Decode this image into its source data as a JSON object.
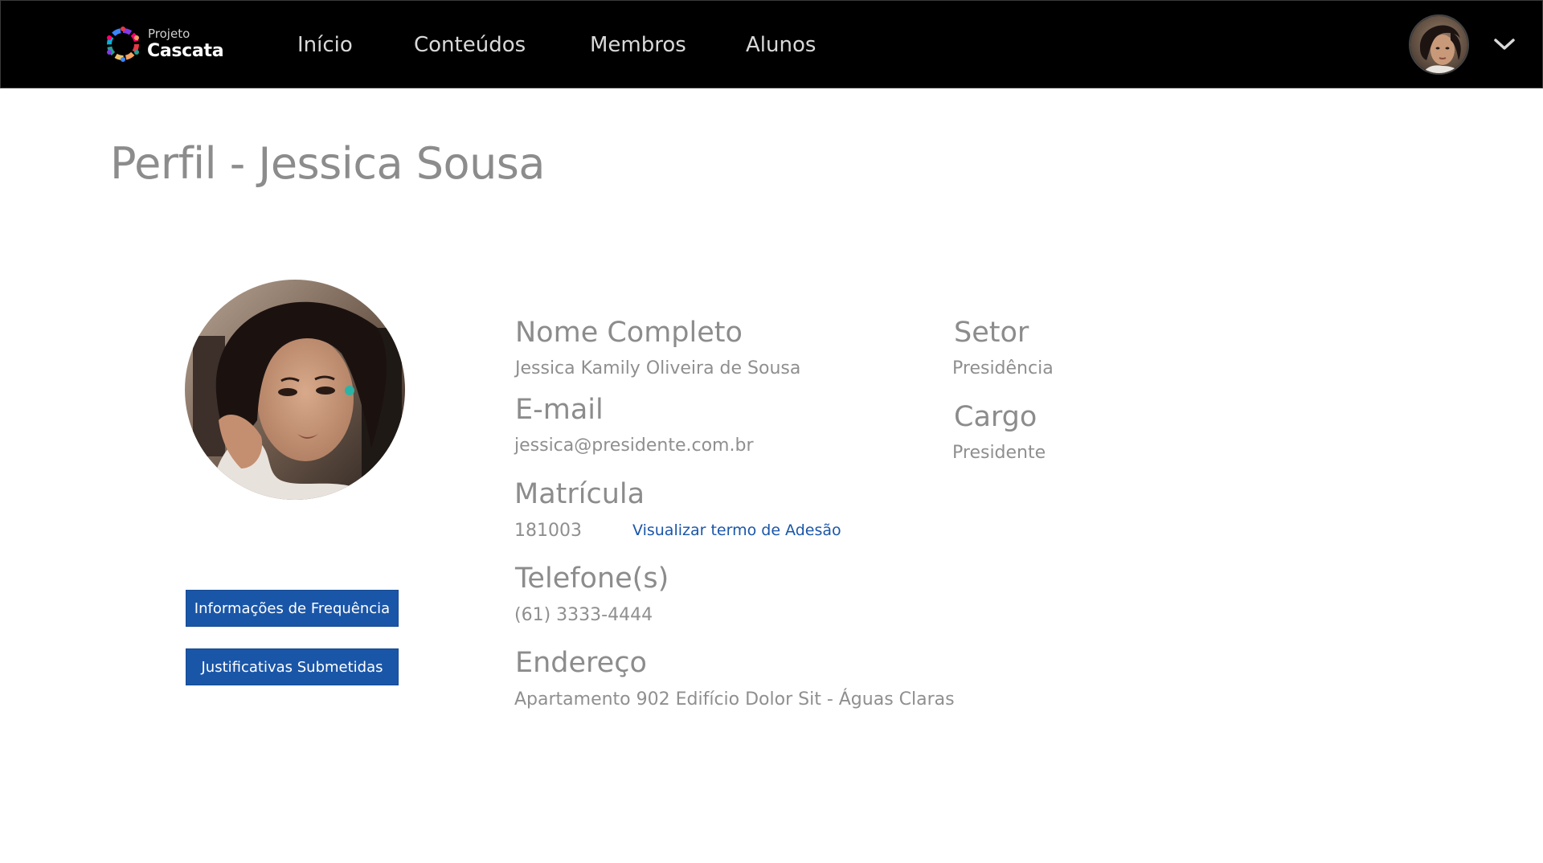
{
  "nav": {
    "logo_small": "Projeto",
    "logo_big": "Cascata",
    "links": [
      "Início",
      "Conteúdos",
      "Membros",
      "Alunos"
    ],
    "menu_icon": "chevron-down-icon"
  },
  "page": {
    "title": "Perfil - Jessica Sousa"
  },
  "actions": {
    "frequency_button": "Informações de Frequência",
    "justifications_button": "Justificativas Submetidas"
  },
  "profile": {
    "name_label": "Nome Completo",
    "name_value": "Jessica Kamily Oliveira de Sousa",
    "email_label": "E-mail",
    "email_value": "jessica@presidente.com.br",
    "registration_label": "Matrícula",
    "registration_value": "181003",
    "term_link": "Visualizar termo de Adesão",
    "phone_label": "Telefone(s)",
    "phone_value": "(61) 3333-4444",
    "address_label": "Endereço",
    "address_value": "Apartamento 902 Edifício Dolor Sit - Águas Claras",
    "sector_label": "Setor",
    "sector_value": "Presidência",
    "role_label": "Cargo",
    "role_value": "Presidente"
  },
  "colors": {
    "navbar_bg": "#000000",
    "accent": "#1a56a8",
    "text_gray": "#8c8c8c"
  }
}
